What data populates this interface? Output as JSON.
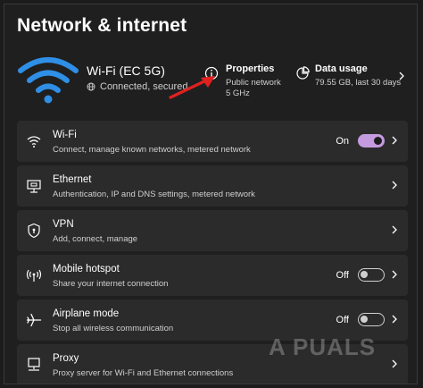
{
  "page": {
    "title": "Network & internet"
  },
  "hero": {
    "network_name": "Wi-Fi (EC 5G)",
    "status": "Connected, secured",
    "properties": {
      "title": "Properties",
      "line1": "Public network",
      "line2": "5 GHz"
    },
    "data_usage": {
      "title": "Data usage",
      "line1": "79.55 GB, last 30 days"
    }
  },
  "rows": [
    {
      "label": "Wi-Fi",
      "desc": "Connect, manage known networks, metered network",
      "state": "On",
      "toggle": "on",
      "icon": "wifi-icon"
    },
    {
      "label": "Ethernet",
      "desc": "Authentication, IP and DNS settings, metered network",
      "state": "",
      "toggle": "none",
      "icon": "ethernet-icon"
    },
    {
      "label": "VPN",
      "desc": "Add, connect, manage",
      "state": "",
      "toggle": "none",
      "icon": "shield-icon"
    },
    {
      "label": "Mobile hotspot",
      "desc": "Share your internet connection",
      "state": "Off",
      "toggle": "off",
      "icon": "hotspot-icon"
    },
    {
      "label": "Airplane mode",
      "desc": "Stop all wireless communication",
      "state": "Off",
      "toggle": "off",
      "icon": "airplane-icon"
    },
    {
      "label": "Proxy",
      "desc": "Proxy server for Wi-Fi and Ethernet connections",
      "state": "",
      "toggle": "none",
      "icon": "proxy-icon"
    }
  ],
  "colors": {
    "accent": "#c59be0",
    "annotation_arrow": "#e0211f",
    "wifi_hero": "#2f8fe6"
  },
  "watermark": "A PUALS"
}
